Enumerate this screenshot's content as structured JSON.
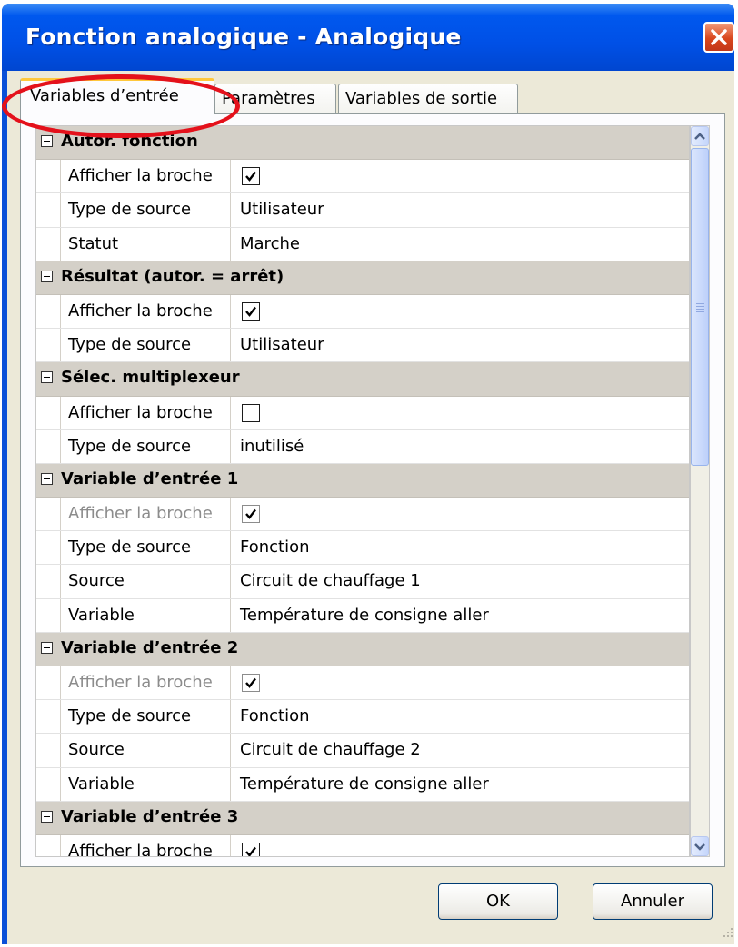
{
  "window": {
    "title": "Fonction analogique - Analogique"
  },
  "tabs": [
    {
      "label": "Variables d’entrée",
      "active": true
    },
    {
      "label": "Paramètres",
      "active": false
    },
    {
      "label": "Variables de sortie",
      "active": false
    }
  ],
  "property_grid": {
    "categories": [
      {
        "name": "Autor. fonction",
        "rows": [
          {
            "label": "Afficher la broche",
            "checked": true,
            "disabled": false
          },
          {
            "label": "Type de source",
            "value": "Utilisateur"
          },
          {
            "label": "Statut",
            "value": "Marche"
          }
        ]
      },
      {
        "name": "Résultat (autor. = arrêt)",
        "rows": [
          {
            "label": "Afficher la broche",
            "checked": true,
            "disabled": false
          },
          {
            "label": "Type de source",
            "value": "Utilisateur"
          }
        ]
      },
      {
        "name": "Sélec. multiplexeur",
        "rows": [
          {
            "label": "Afficher la broche",
            "checked": false,
            "disabled": false
          },
          {
            "label": "Type de source",
            "value": "inutilisé"
          }
        ]
      },
      {
        "name": "Variable d’entrée 1",
        "rows": [
          {
            "label": "Afficher la broche",
            "checked": true,
            "disabled": true
          },
          {
            "label": "Type de source",
            "value": "Fonction"
          },
          {
            "label": "Source",
            "value": "Circuit de chauffage 1"
          },
          {
            "label": "Variable",
            "value": "Température de consigne aller"
          }
        ]
      },
      {
        "name": "Variable d’entrée 2",
        "rows": [
          {
            "label": "Afficher la broche",
            "checked": true,
            "disabled": true
          },
          {
            "label": "Type de source",
            "value": "Fonction"
          },
          {
            "label": "Source",
            "value": "Circuit de chauffage 2"
          },
          {
            "label": "Variable",
            "value": "Température de consigne aller"
          }
        ]
      },
      {
        "name": "Variable d’entrée 3",
        "rows": [
          {
            "label": "Afficher la broche",
            "checked": true,
            "disabled": false
          }
        ]
      }
    ]
  },
  "buttons": {
    "ok": "OK",
    "cancel": "Annuler"
  },
  "annotation": {
    "color": "#e4111b"
  }
}
